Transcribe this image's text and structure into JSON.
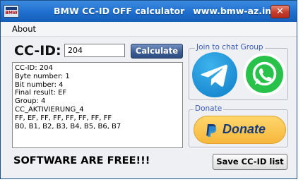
{
  "window": {
    "icon_text": "BMW",
    "title": "BMW CC-ID OFF calculator",
    "url": "www.bmw-az.info",
    "close_glyph": "✕"
  },
  "menu": {
    "about_label": "About"
  },
  "form": {
    "ccid_label": "CC-ID:",
    "ccid_value": "204",
    "calculate_label": "Calculate"
  },
  "output": {
    "lines": [
      "CC-ID: 204",
      "Byte number: 1",
      "Bit number: 4",
      "Final result: EF",
      "Group: 4",
      "CC_AKTIVIERUNG_4",
      "FF, EF, FF, FF, FF, FF, FF, FF",
      "B0, B1, B2, B3, B4, B5, B6, B7"
    ]
  },
  "chat_group": {
    "label": "Join to chat Group",
    "telegram_icon": "telegram-icon",
    "whatsapp_icon": "whatsapp-icon"
  },
  "donate_group": {
    "label": "Donate",
    "button_label": "Donate",
    "icon": "paypal-icon"
  },
  "footer": {
    "message": "SOFTWARE ARE FREE!!!",
    "save_label": "Save CC-ID list"
  },
  "colors": {
    "titlebar": "#1e6fcf",
    "group_label": "#3a5ab8",
    "calculate_button": "#3f5e93",
    "telegram": "#1a8ad1",
    "whatsapp": "#28c24a",
    "donate_button": "#f6b73c"
  }
}
